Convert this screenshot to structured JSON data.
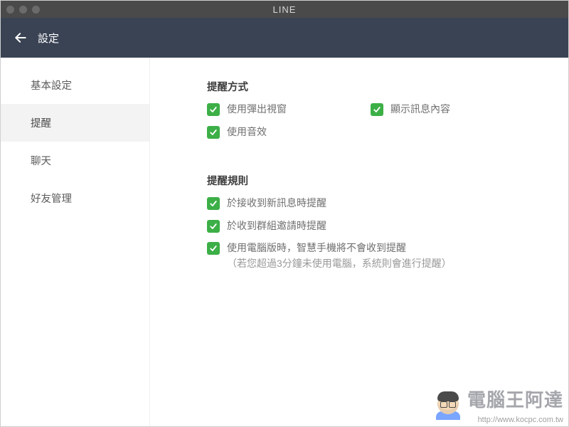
{
  "window": {
    "title": "LINE"
  },
  "header": {
    "title": "設定"
  },
  "sidebar": {
    "items": [
      {
        "id": "basic",
        "label": "基本設定",
        "active": false
      },
      {
        "id": "notify",
        "label": "提醒",
        "active": true
      },
      {
        "id": "chat",
        "label": "聊天",
        "active": false
      },
      {
        "id": "friends",
        "label": "好友管理",
        "active": false
      }
    ]
  },
  "content": {
    "section_method": {
      "title": "提醒方式",
      "items": [
        {
          "id": "popup",
          "label": "使用彈出視窗",
          "checked": true
        },
        {
          "id": "preview",
          "label": "顯示訊息內容",
          "checked": true
        },
        {
          "id": "sound",
          "label": "使用音效",
          "checked": true
        }
      ]
    },
    "section_rules": {
      "title": "提醒規則",
      "items": [
        {
          "id": "new-msg",
          "label": "於接收到新訊息時提醒",
          "checked": true
        },
        {
          "id": "group-invite",
          "label": "於收到群組邀請時提醒",
          "checked": true
        },
        {
          "id": "desktop-mute",
          "label": "使用電腦版時，智慧手機將不會收到提醒",
          "sub": "（若您超過3分鐘未使用電腦，系統則會進行提醒）",
          "checked": true
        }
      ]
    }
  },
  "watermark": {
    "main": "電腦王阿達",
    "sub": "http://www.kocpc.com.tw"
  },
  "colors": {
    "accent": "#3caf47",
    "header": "#3a4354",
    "titlebar": "#4a4a4a"
  }
}
